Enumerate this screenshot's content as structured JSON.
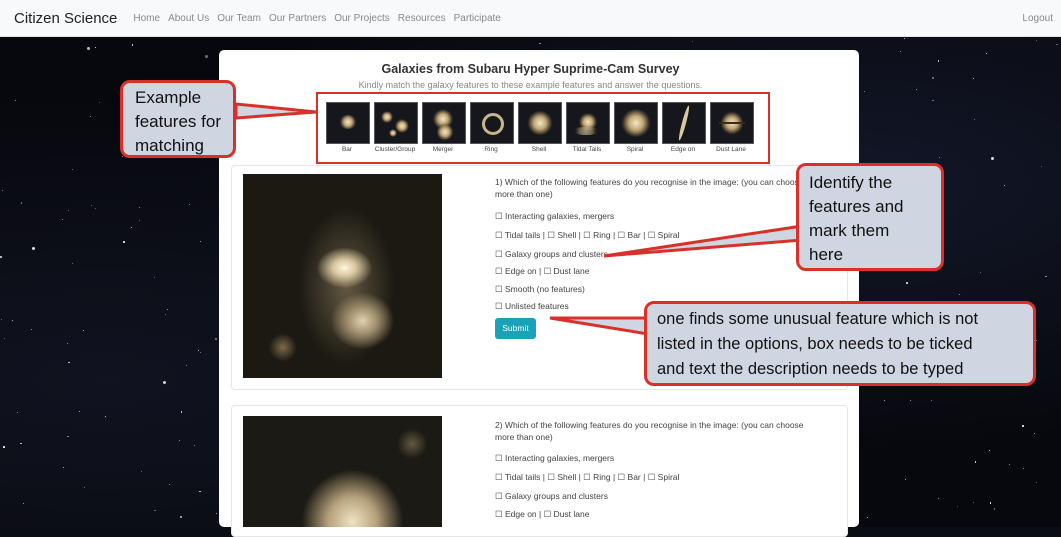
{
  "navbar": {
    "brand": "Citizen Science",
    "links": [
      "Home",
      "About Us",
      "Our Team",
      "Our Partners",
      "Our Projects",
      "Resources",
      "Participate"
    ],
    "logout": "Logout"
  },
  "survey": {
    "title": "Galaxies from Subaru Hyper Suprime-Cam Survey",
    "subtitle": "Kindly match the galaxy features to these example features and answer the questions.",
    "examples": [
      "Bar",
      "Cluster/Group",
      "Merger",
      "Ring",
      "Shell",
      "Tidal Tails",
      "Spiral",
      "Edge on",
      "Dust Lane"
    ]
  },
  "question1": {
    "text_line1": "1) Which of the following features do you recognise in the image: (you can choose",
    "text_line2": "more than one)",
    "options": [
      "☐ Interacting galaxies, mergers",
      "☐ Tidal tails | ☐ Shell | ☐ Ring | ☐ Bar | ☐ Spiral",
      "☐ Galaxy groups and clusters",
      "☐ Edge on | ☐ Dust lane",
      "☐ Smooth (no features)",
      "☐ Unlisted features"
    ],
    "submit": "Submit"
  },
  "question2": {
    "text_line1": "2) Which of the following features do you recognise in the image: (you can choose",
    "text_line2": "more than one)",
    "options": [
      "☐ Interacting galaxies, mergers",
      "☐ Tidal tails | ☐ Shell | ☐ Ring | ☐ Bar | ☐ Spiral",
      "☐ Galaxy groups and clusters",
      "☐ Edge on | ☐ Dust lane"
    ]
  },
  "callouts": {
    "examples": [
      "Example",
      "features for",
      "matching"
    ],
    "identify": [
      "Identify the",
      "features and",
      "mark them",
      "here"
    ],
    "unlisted": [
      "one finds some unusual feature which is not",
      "listed in the options, box needs to be ticked",
      "and text the description needs to be typed"
    ]
  },
  "colors": {
    "accent": "#1aa3b8",
    "callout_border": "#d9312a",
    "callout_fill": "#cfd6e2"
  }
}
